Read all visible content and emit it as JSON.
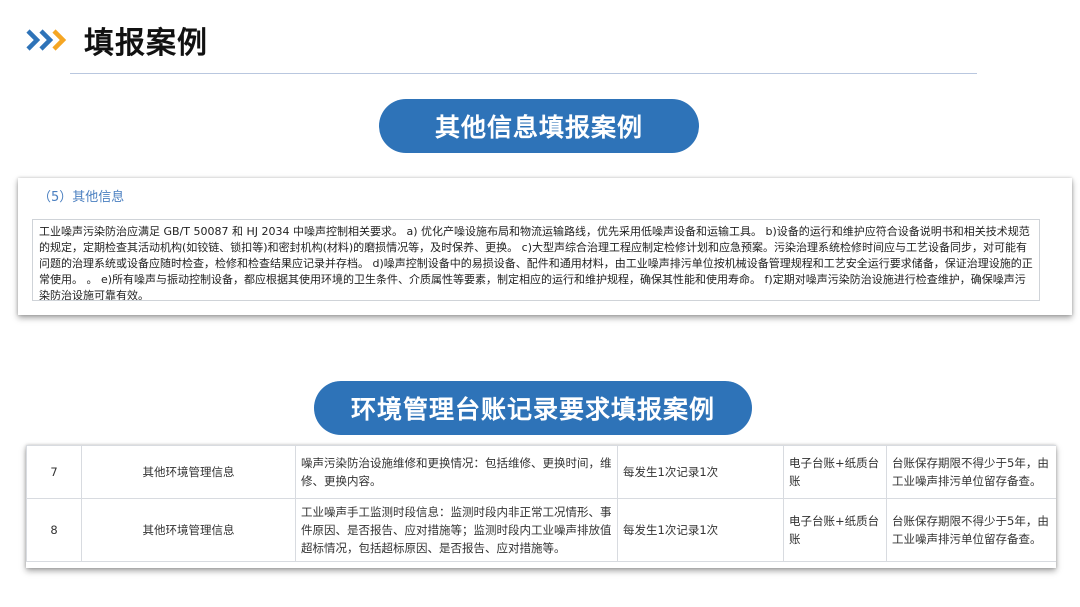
{
  "slide": {
    "title": "填报案例",
    "accent_color": "#2e73b8",
    "chevron_colors": [
      "#2e73b8",
      "#2e73b8",
      "#f5a623"
    ]
  },
  "section1": {
    "label": "其他信息填报案例",
    "panel_heading": "（5）其他信息",
    "text": "工业噪声污染防治应满足 GB/T 50087 和 HJ 2034 中噪声控制相关要求。 a) 优化产噪设施布局和物流运输路线，优先采用低噪声设备和运输工具。 b)设备的运行和维护应符合设备说明书和相关技术规范的规定，定期检查其活动机构(如铰链、锁扣等)和密封机构(材料)的磨损情况等，及时保养、更换。 c)大型声综合治理工程应制定检修计划和应急预案。污染治理系统检修时间应与工艺设备同步，对可能有问题的治理系统或设备应随时检查，检修和检查结果应记录并存档。 d)噪声控制设备中的易损设备、配件和通用材料，由工业噪声排污单位按机械设备管理规程和工艺安全运行要求储备，保证治理设施的正常使用。 。 e)所有噪声与振动控制设备，都应根据其使用环境的卫生条件、介质属性等要素，制定相应的运行和维护规程，确保其性能和使用寿命。 f)定期对噪声污染防治设施进行检查维护，确保噪声污染防治设施可靠有效。"
  },
  "section2": {
    "label": "环境管理台账记录要求填报案例",
    "rows": [
      {
        "no": "7",
        "category": "其他环境管理信息",
        "content": "噪声污染防治设施维修和更换情况：包括维修、更换时间，维修、更换内容。",
        "frequency": "每发生1次记录1次",
        "form": "电子台账+纸质台账",
        "retention": "台账保存期限不得少于5年，由工业噪声排污单位留存备查。"
      },
      {
        "no": "8",
        "category": "其他环境管理信息",
        "content": "工业噪声手工监测时段信息：监测时段内非正常工况情形、事件原因、是否报告、应对措施等；监测时段内工业噪声排放值超标情况，包括超标原因、是否报告、应对措施等。",
        "frequency": "每发生1次记录1次",
        "form": "电子台账+纸质台账",
        "retention": "台账保存期限不得少于5年，由工业噪声排污单位留存备查。"
      }
    ]
  }
}
